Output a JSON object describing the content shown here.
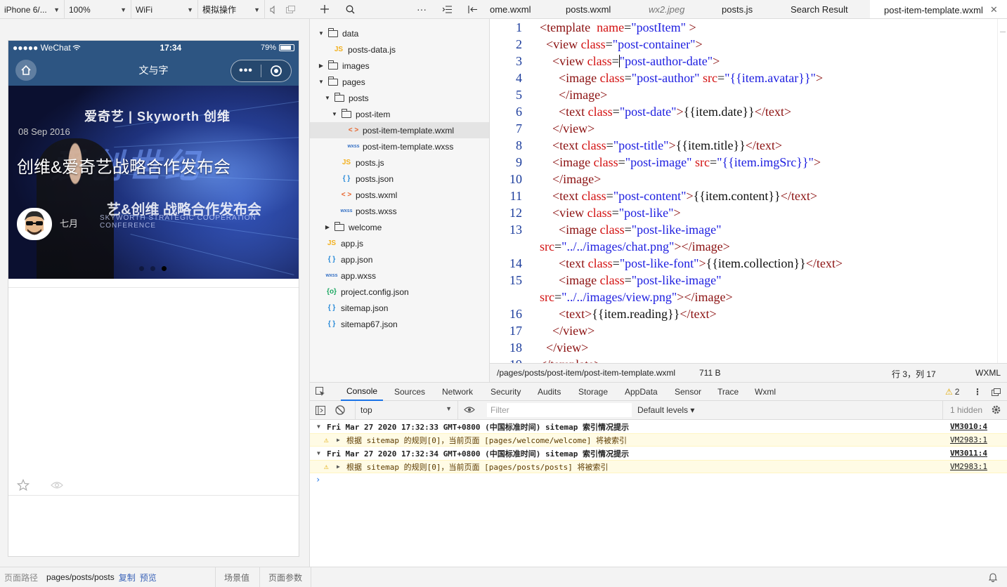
{
  "sim_toolbar": {
    "device": "iPhone 6/...",
    "zoom": "100%",
    "network": "WiFi",
    "operation": "模拟操作"
  },
  "phone": {
    "status": {
      "carrier": "●●●●● WeChat",
      "time": "17:34",
      "battery": "79%"
    },
    "nav_title": "文与字",
    "banner": {
      "brand": "爱奇艺 | Skyworth 创维",
      "big_text": "爱创世纪",
      "sub_text": "艺&创维 战略合作发布会",
      "sub_text_en": "SKYWORTH STRATEGIC COOPERATION CONFERENCE"
    },
    "post_date": "08 Sep 2016",
    "post_title": "创维&爱奇艺战略合作发布会",
    "author": "七月"
  },
  "bottom_bar": {
    "path_label": "页面路径",
    "path_value": "pages/posts/posts",
    "copy": "复制",
    "preview": "预览",
    "scene": "场景值",
    "params": "页面参数"
  },
  "tree": {
    "rows": [
      {
        "label": "data",
        "type": "folder"
      },
      {
        "label": "posts-data.js",
        "type": "js"
      },
      {
        "label": "images",
        "type": "folder"
      },
      {
        "label": "pages",
        "type": "folder"
      },
      {
        "label": "posts",
        "type": "folder"
      },
      {
        "label": "post-item",
        "type": "folder"
      },
      {
        "label": "post-item-template.wxml",
        "type": "wxml"
      },
      {
        "label": "post-item-template.wxss",
        "type": "wxss"
      },
      {
        "label": "posts.js",
        "type": "js"
      },
      {
        "label": "posts.json",
        "type": "json"
      },
      {
        "label": "posts.wxml",
        "type": "wxml"
      },
      {
        "label": "posts.wxss",
        "type": "wxss"
      },
      {
        "label": "welcome",
        "type": "folder"
      },
      {
        "label": "app.js",
        "type": "js"
      },
      {
        "label": "app.json",
        "type": "json"
      },
      {
        "label": "app.wxss",
        "type": "wxss"
      },
      {
        "label": "project.config.json",
        "type": "config"
      },
      {
        "label": "sitemap.json",
        "type": "json"
      },
      {
        "label": "sitemap67.json",
        "type": "json"
      }
    ],
    "icon_glyphs": {
      "js": "JS",
      "json": "{ }",
      "wxml": "< >",
      "wxss": "wxss",
      "config": "{o}"
    }
  },
  "editor_tabs": [
    {
      "label": "ome.wxml"
    },
    {
      "label": "posts.wxml"
    },
    {
      "label": "wx2.jpeg"
    },
    {
      "label": "posts.js"
    },
    {
      "label": "Search Result"
    },
    {
      "label": "post-item-template.wxml"
    }
  ],
  "editor": {
    "line_numbers": [
      "1",
      "2",
      "3",
      "4",
      "5",
      "6",
      "7",
      "8",
      "9",
      "10",
      "11",
      "12",
      "13",
      "",
      "14",
      "15",
      "",
      "16",
      "17",
      "18",
      "19"
    ],
    "status": {
      "path": "/pages/posts/post-item/post-item-template.wxml",
      "size": "711 B",
      "cursor": "行 3，列 17",
      "lang": "WXML"
    }
  },
  "devtools": {
    "tabs": [
      "Console",
      "Sources",
      "Network",
      "Security",
      "Audits",
      "Storage",
      "AppData",
      "Sensor",
      "Trace",
      "Wxml"
    ],
    "warning_count": "2",
    "context": "top",
    "filter_placeholder": "Filter",
    "levels": "Default levels ▾",
    "hidden": "1 hidden",
    "console": [
      {
        "kind": "group",
        "text": "Fri Mar 27 2020 17:32:33 GMT+0800 (中国标准时间) sitemap 索引情况提示",
        "src": "VM3010:4"
      },
      {
        "kind": "warn",
        "text": "根据 sitemap 的规则[0]，当前页面 [pages/welcome/welcome] 将被索引",
        "src": "VM2983:1"
      },
      {
        "kind": "group",
        "text": "Fri Mar 27 2020 17:32:34 GMT+0800 (中国标准时间) sitemap 索引情况提示",
        "src": "VM3011:4"
      },
      {
        "kind": "warn",
        "text": "根据 sitemap 的规则[0]，当前页面 [pages/posts/posts] 将被索引",
        "src": "VM2983:1"
      }
    ],
    "prompt": "›"
  }
}
